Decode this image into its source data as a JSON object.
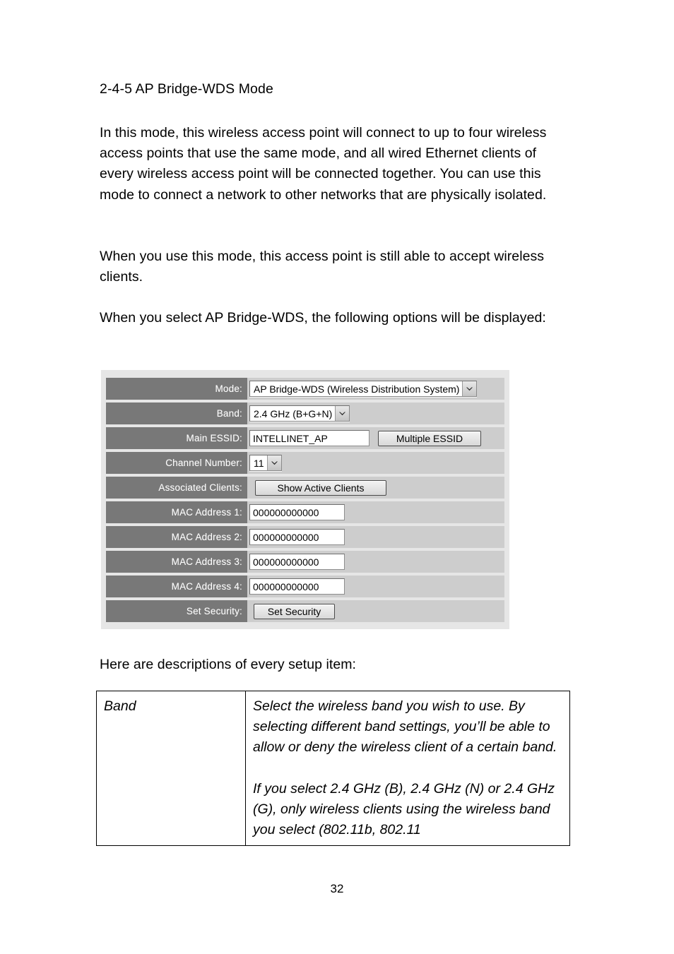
{
  "document": {
    "heading": "2-4-5 AP Bridge-WDS Mode",
    "paragraph_1": "In this mode, this wireless access point will connect to up to four wireless access points that use the same mode, and all wired Ethernet clients of every wireless access point will be connected together. You can use this mode to connect a network to other networks that are physically isolated.",
    "paragraph_2": "When you use this mode, this access point is still able to accept wireless clients.",
    "paragraph_3": "When you select AP Bridge-WDS, the following options will be displayed:",
    "paragraph_4": "Here are descriptions of every setup item:",
    "page_number": "32"
  },
  "panel": {
    "rows": [
      {
        "label": "Mode:",
        "widget": "select",
        "value": "AP Bridge-WDS (Wireless Distribution System)"
      },
      {
        "label": "Band:",
        "widget": "select",
        "value": "2.4 GHz (B+G+N)"
      },
      {
        "label": "Main ESSID:",
        "widget": "text-with-button",
        "value": "INTELLINET_AP",
        "button": "Multiple ESSID"
      },
      {
        "label": "Channel Number:",
        "widget": "select",
        "value": "11"
      },
      {
        "label": "Associated Clients:",
        "widget": "button",
        "button": "Show Active Clients"
      },
      {
        "label": "MAC Address 1:",
        "widget": "text",
        "value": "000000000000"
      },
      {
        "label": "MAC Address 2:",
        "widget": "text",
        "value": "000000000000"
      },
      {
        "label": "MAC Address 3:",
        "widget": "text",
        "value": "000000000000"
      },
      {
        "label": "MAC Address 4:",
        "widget": "text",
        "value": "000000000000"
      },
      {
        "label": "Set Security:",
        "widget": "button",
        "button": "Set Security"
      }
    ],
    "colors": {
      "panel_background": "#e6e6e6",
      "label_background": "#787878",
      "label_text": "#ffffff",
      "value_background": "#cdcdcd"
    }
  },
  "description_table": {
    "rows": [
      {
        "term": "Band",
        "paragraphs": [
          "Select the wireless band you wish to use. By selecting different band settings, you’ll be able to allow or deny the wireless client of a certain band.",
          "If you select 2.4 GHz (B), 2.4 GHz (N) or 2.4 GHz (G), only wireless clients using the wireless band you select (802.11b, 802.11"
        ]
      }
    ]
  }
}
